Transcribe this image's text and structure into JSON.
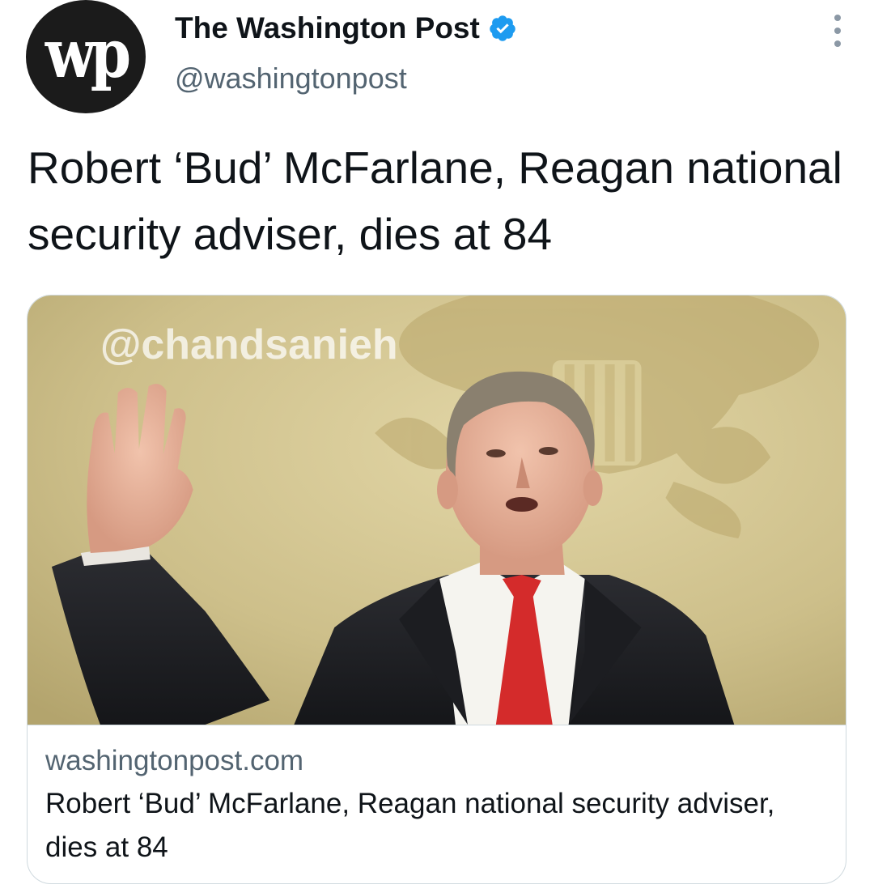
{
  "author": {
    "logo_text": "wp",
    "name": "The Washington Post",
    "handle": "@washingtonpost",
    "verified_icon": "verified-badge-icon",
    "more_icon": "more-options-icon"
  },
  "tweet": {
    "text": "Robert ‘Bud’ McFarlane, Reagan national security adviser, dies at 84"
  },
  "card": {
    "image_watermark": "@chandsanieh",
    "domain": "washingtonpost.com",
    "title": "Robert ‘Bud’ McFarlane, Reagan national security adviser, dies at 84"
  },
  "colors": {
    "verified": "#1d9bf0",
    "secondary_text": "#536471",
    "border": "#cfd9de",
    "tie": "#d42b2b",
    "suit": "#1f2024",
    "wall": "#cdbf8a"
  }
}
